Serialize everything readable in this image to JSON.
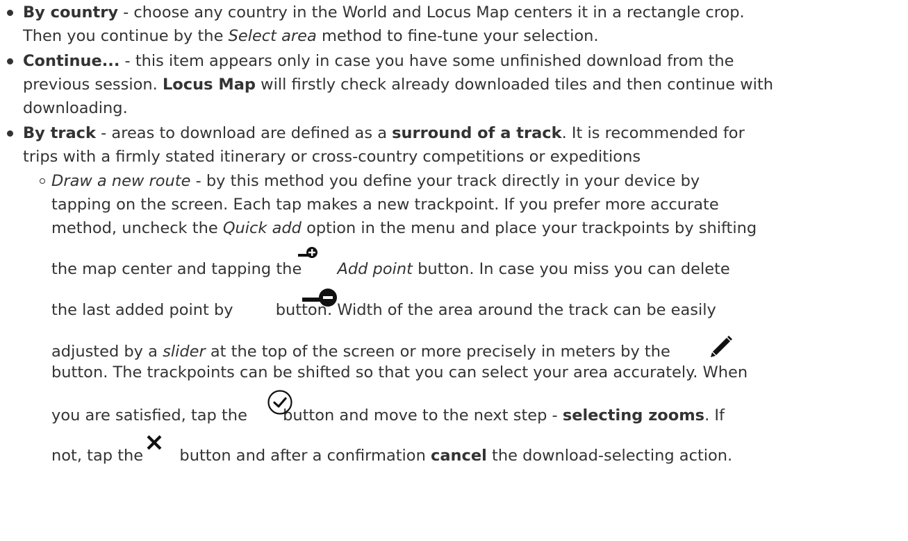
{
  "items": [
    {
      "term": "By country",
      "p1": " - choose any country in the World and Locus Map centers it in a rectangle crop.",
      "p2": "Then you continue by the ",
      "em": "Select area",
      "p3": " method to fine-tune your selection."
    },
    {
      "term": "Continue...",
      "p1": " - this item appears only in case you have some unfinished download from the",
      "p2": "previous session. ",
      "strong": "Locus Map",
      "p3": " will firstly check already downloaded tiles and then continue with",
      "p4": "downloading."
    },
    {
      "term": "By track",
      "p1": " - areas to download are defined as a ",
      "strong": "surround of a track",
      "p2": ". It is recommended for",
      "p3": "trips with a firmly stated itinerary or cross-country competitions or expeditions",
      "sub": {
        "em1": "Draw a new route",
        "l1": " - by this method you define your track directly in your device by",
        "l2": "tapping on the screen. Each tap makes a new trackpoint. If you prefer more accurate",
        "l3a": "method, uncheck the ",
        "em2": "Quick add",
        "l3b": " option in the menu and place your trackpoints by shifting",
        "l4a": "the map center and tapping the ",
        "em3": "Add point",
        "l4b": " button. In case you miss you can delete",
        "l5a": "the last added point by ",
        "l5b": "button. Width of the area around the track can be easily",
        "l6a": "adjusted by a ",
        "em4": "slider",
        "l6b": " at the top of the screen or more precisely in meters by the",
        "l7": "button. The trackpoints can be shifted so that you can select your area accurately. When",
        "l8a": "you are satisfied, tap the ",
        "l8b": "button and move to the next step - ",
        "strong1": "selecting zooms",
        "l8c": ". If",
        "l9a": "not, tap the ",
        "l9b": " button and after a confirmation ",
        "strong2": "cancel",
        "l9c": " the download-selecting action."
      }
    }
  ],
  "icons": {
    "add_point": "add-point-icon",
    "delete_point": "delete-point-icon",
    "edit": "pencil-icon",
    "confirm": "check-circle-icon",
    "cancel": "close-icon"
  }
}
